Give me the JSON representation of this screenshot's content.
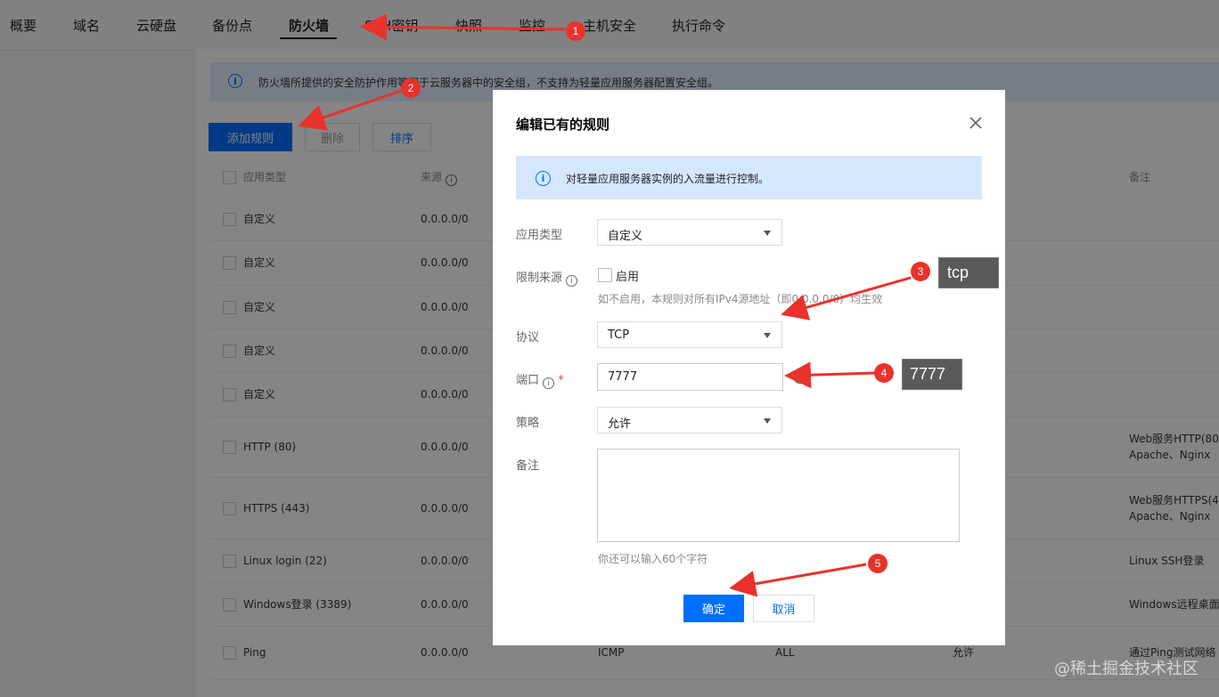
{
  "nav": {
    "tabs": [
      "概要",
      "域名",
      "云硬盘",
      "备份点",
      "防火墙",
      "SSH密钥",
      "快照",
      "监控",
      "主机安全",
      "执行命令"
    ],
    "active_index": 4
  },
  "notice": {
    "text": "防火墙所提供的安全防护作用等同于云服务器中的安全组，不支持为轻量应用服务器配置安全组。"
  },
  "toolbar": {
    "add_label": "添加规则",
    "delete_label": "删除",
    "sort_label": "排序"
  },
  "table": {
    "headers": {
      "type": "应用类型",
      "source": "来源",
      "remark": "备注"
    },
    "rows": [
      {
        "type": "自定义",
        "source": "0.0.0.0/0",
        "protocol": "",
        "port": "",
        "policy": "",
        "remark": "",
        "remark2": ""
      },
      {
        "type": "自定义",
        "source": "0.0.0.0/0",
        "protocol": "",
        "port": "",
        "policy": "",
        "remark": "",
        "remark2": ""
      },
      {
        "type": "自定义",
        "source": "0.0.0.0/0",
        "protocol": "",
        "port": "",
        "policy": "",
        "remark": "",
        "remark2": ""
      },
      {
        "type": "自定义",
        "source": "0.0.0.0/0",
        "protocol": "",
        "port": "",
        "policy": "",
        "remark": "",
        "remark2": ""
      },
      {
        "type": "自定义",
        "source": "0.0.0.0/0",
        "protocol": "",
        "port": "",
        "policy": "",
        "remark": "",
        "remark2": ""
      },
      {
        "type": "HTTP (80)",
        "source": "0.0.0.0/0",
        "protocol": "",
        "port": "",
        "policy": "",
        "remark": "Web服务HTTP(80",
        "remark2": "Apache、Nginx"
      },
      {
        "type": "HTTPS (443)",
        "source": "0.0.0.0/0",
        "protocol": "",
        "port": "",
        "policy": "",
        "remark": "Web服务HTTPS(4",
        "remark2": "Apache、Nginx"
      },
      {
        "type": "Linux login (22)",
        "source": "0.0.0.0/0",
        "protocol": "",
        "port": "",
        "policy": "",
        "remark": "Linux SSH登录",
        "remark2": ""
      },
      {
        "type": "Windows登录 (3389)",
        "source": "0.0.0.0/0",
        "protocol": "",
        "port": "",
        "policy": "",
        "remark": "Windows远程桌面",
        "remark2": ""
      },
      {
        "type": "Ping",
        "source": "0.0.0.0/0",
        "protocol": "ICMP",
        "port": "ALL",
        "policy": "允许",
        "remark": "通过Ping测试网络",
        "remark2": ""
      }
    ]
  },
  "modal": {
    "title": "编辑已有的规则",
    "notice": "对轻量应用服务器实例的入流量进行控制。",
    "app_type_label": "应用类型",
    "app_type_value": "自定义",
    "limit_source_label": "限制来源",
    "enable_label": "启用",
    "limit_hint": "如不启用，本规则对所有IPv4源地址（即0.0.0.0/0）均生效",
    "protocol_label": "协议",
    "protocol_value": "TCP",
    "port_label": "端口",
    "port_value": "7777",
    "required_mark": "*",
    "policy_label": "策略",
    "policy_value": "允许",
    "remark_label": "备注",
    "remark_hint": "你还可以输入60个字符",
    "ok_label": "确定",
    "cancel_label": "取消"
  },
  "annotations": {
    "badges": [
      "1",
      "2",
      "3",
      "4",
      "5"
    ],
    "callout_protocol": "tcp",
    "callout_port": "7777",
    "arrow_color": "#e8322b"
  },
  "watermark": "@稀土掘金技术社区",
  "colors": {
    "primary": "#006eff",
    "success": "#0abf5b",
    "overlay": "rgba(0,0,0,0.48)"
  }
}
